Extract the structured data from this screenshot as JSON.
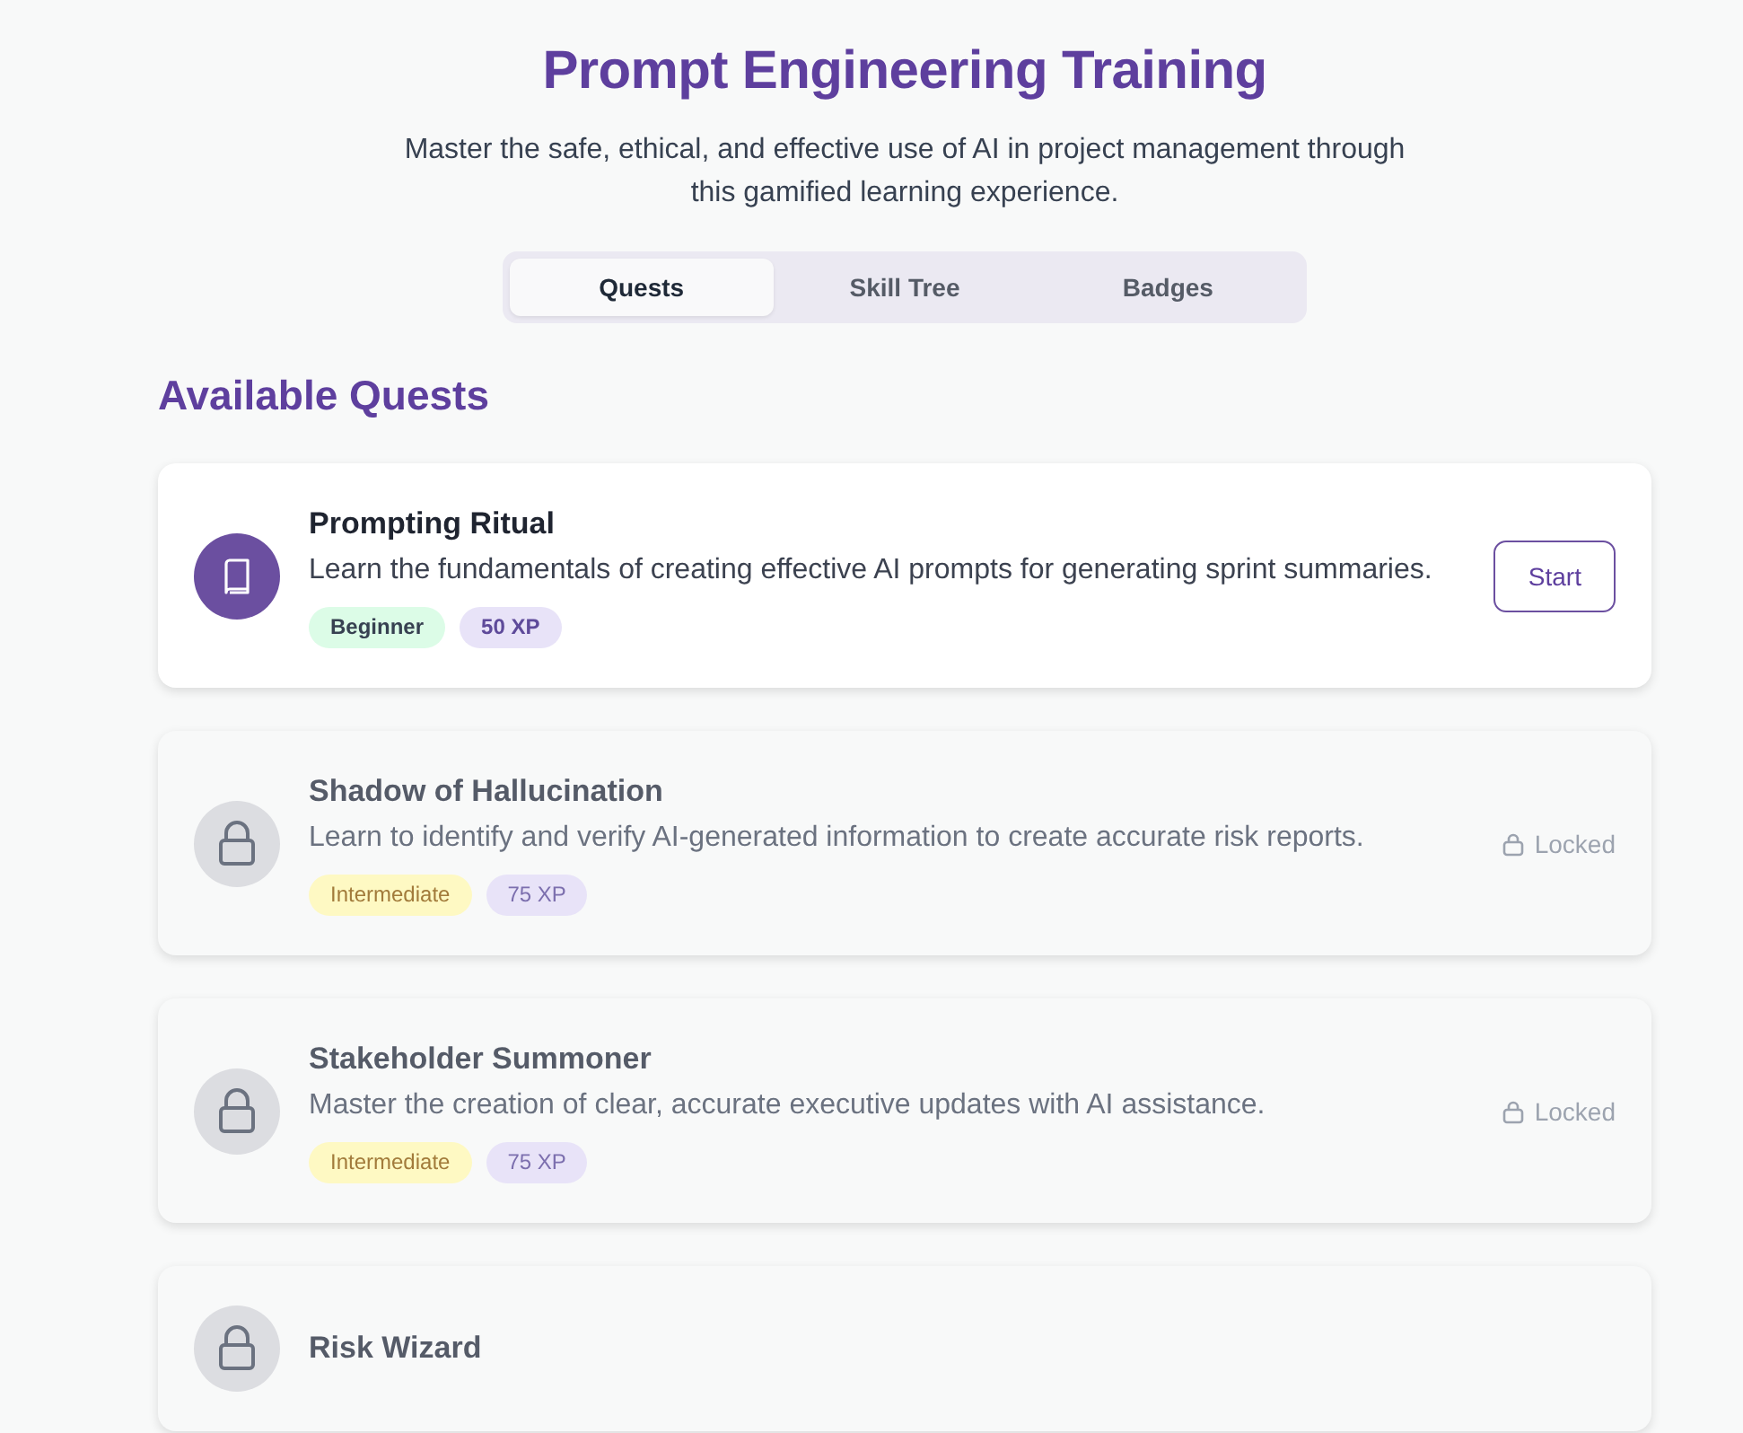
{
  "header": {
    "title": "Prompt Engineering Training",
    "subtitle": "Master the safe, ethical, and effective use of AI in project management through this gamified learning experience."
  },
  "tabs": [
    {
      "label": "Quests",
      "selected": true
    },
    {
      "label": "Skill Tree",
      "selected": false
    },
    {
      "label": "Badges",
      "selected": false
    }
  ],
  "section_title": "Available Quests",
  "quests": [
    {
      "title": "Prompting Ritual",
      "description": "Learn the fundamentals of creating effective AI prompts for generating sprint summaries.",
      "difficulty": {
        "label": "Beginner",
        "kind": "beginner"
      },
      "xp": "50 XP",
      "locked": false,
      "action": "Start"
    },
    {
      "title": "Shadow of Hallucination",
      "description": "Learn to identify and verify AI-generated information to create accurate risk reports.",
      "difficulty": {
        "label": "Intermediate",
        "kind": "intermediate"
      },
      "xp": "75 XP",
      "locked": true,
      "action": "Locked"
    },
    {
      "title": "Stakeholder Summoner",
      "description": "Master the creation of clear, accurate executive updates with AI assistance.",
      "difficulty": {
        "label": "Intermediate",
        "kind": "intermediate"
      },
      "xp": "75 XP",
      "locked": true,
      "action": "Locked"
    },
    {
      "title": "Risk Wizard",
      "locked": true
    }
  ]
}
